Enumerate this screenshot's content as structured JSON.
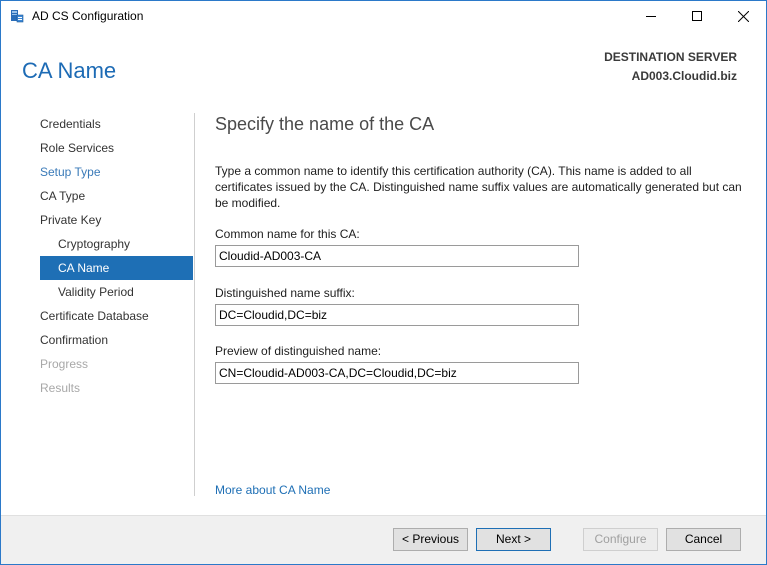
{
  "window": {
    "title": "AD CS Configuration",
    "icon": "server-config-icon"
  },
  "header": {
    "page_title": "CA Name",
    "destination_label": "DESTINATION SERVER",
    "destination_server": "AD003.Cloudid.biz"
  },
  "sidebar": {
    "items": [
      {
        "label": "Credentials",
        "state": "normal"
      },
      {
        "label": "Role Services",
        "state": "normal"
      },
      {
        "label": "Setup Type",
        "state": "link"
      },
      {
        "label": "CA Type",
        "state": "normal"
      },
      {
        "label": "Private Key",
        "state": "normal"
      },
      {
        "label": "Cryptography",
        "state": "normal",
        "sub": true
      },
      {
        "label": "CA Name",
        "state": "selected",
        "sub": true
      },
      {
        "label": "Validity Period",
        "state": "normal",
        "sub": true
      },
      {
        "label": "Certificate Database",
        "state": "normal"
      },
      {
        "label": "Confirmation",
        "state": "normal"
      },
      {
        "label": "Progress",
        "state": "disabled"
      },
      {
        "label": "Results",
        "state": "disabled"
      }
    ]
  },
  "main": {
    "section_title": "Specify the name of the CA",
    "description": "Type a common name to identify this certification authority (CA). This name is added to all certificates issued by the CA. Distinguished name suffix values are automatically generated but can be modified.",
    "common_name_label": "Common name for this CA:",
    "common_name_value": "Cloudid-AD003-CA",
    "dn_suffix_label": "Distinguished name suffix:",
    "dn_suffix_value": "DC=Cloudid,DC=biz",
    "preview_label": "Preview of distinguished name:",
    "preview_value": "CN=Cloudid-AD003-CA,DC=Cloudid,DC=biz",
    "more_link": "More about CA Name"
  },
  "footer": {
    "previous_label": "< Previous",
    "next_label": "Next >",
    "configure_label": "Configure",
    "cancel_label": "Cancel"
  },
  "colors": {
    "accent": "#1e6fb5",
    "title_blue": "#1d6bb5",
    "disabled_text": "#a8a8a8"
  }
}
